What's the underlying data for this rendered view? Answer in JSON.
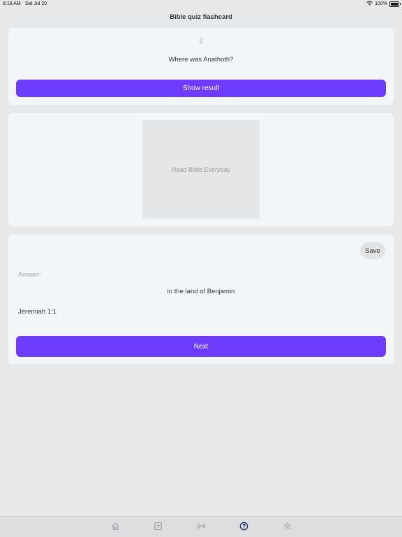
{
  "status_bar": {
    "time": "8:18 AM",
    "date": "Sat Jul 20",
    "battery": "100%"
  },
  "header": {
    "title": "Bible quiz flashcard"
  },
  "question_card": {
    "number": "2",
    "question": "Where was Anathoth?",
    "show_button": "Show result"
  },
  "image_card": {
    "placeholder_text": "Read Bible Everyday"
  },
  "answer_card": {
    "save_label": "Save",
    "answer_label": "Answer:",
    "answer": "in the land of Benjamin",
    "reference": "Jeremiah 1:1",
    "next_button": "Next"
  },
  "tabbar": {
    "items": [
      {
        "icon": "home-icon",
        "active": false
      },
      {
        "icon": "bible-icon",
        "active": false
      },
      {
        "icon": "broadcast-icon",
        "active": false
      },
      {
        "icon": "quiz-icon",
        "active": true
      },
      {
        "icon": "settings-icon",
        "active": false
      }
    ]
  },
  "colors": {
    "accent": "#6c3cff",
    "background": "#e6e8ea",
    "card": "#f3f6f9",
    "active_tab": "#1f2d5c",
    "inactive_tab": "#9a9ea3"
  }
}
